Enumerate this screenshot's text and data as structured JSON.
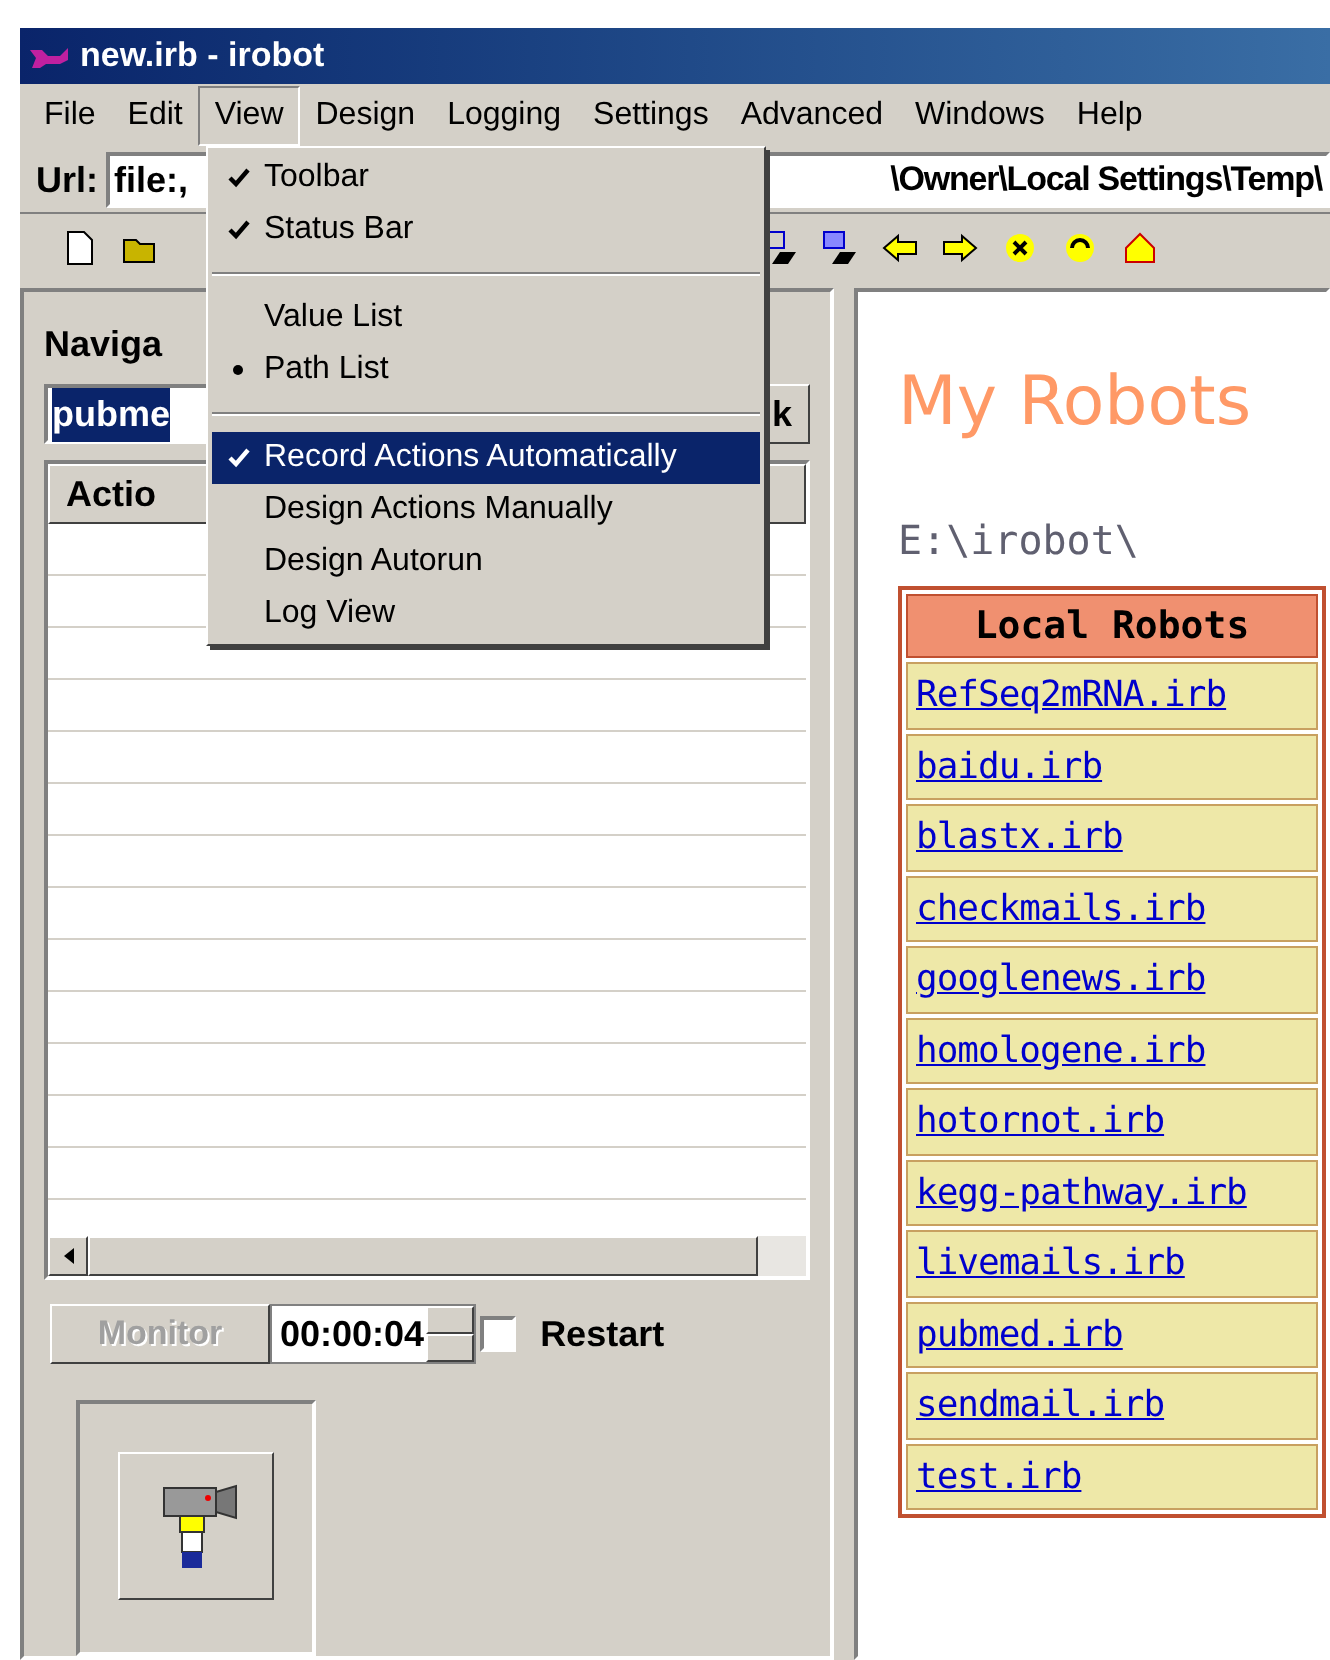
{
  "window": {
    "title": "new.irb - irobot"
  },
  "menu_bar": [
    {
      "label": "File",
      "selected": false
    },
    {
      "label": "Edit",
      "selected": false
    },
    {
      "label": "View",
      "selected": true
    },
    {
      "label": "Design",
      "selected": false
    },
    {
      "label": "Logging",
      "selected": false
    },
    {
      "label": "Settings",
      "selected": false
    },
    {
      "label": "Advanced",
      "selected": false
    },
    {
      "label": "Windows",
      "selected": false
    },
    {
      "label": "Help",
      "selected": false
    }
  ],
  "url": {
    "label": "Url:",
    "value_start": "file:,",
    "value_end": "\\Owner\\Local Settings\\Temp\\"
  },
  "view_menu": [
    {
      "kind": "check",
      "label": "Toolbar",
      "checked": true,
      "selected": false
    },
    {
      "kind": "check",
      "label": "Status Bar",
      "checked": true,
      "selected": false
    },
    {
      "kind": "separator"
    },
    {
      "kind": "plain",
      "label": "Value List",
      "selected": false
    },
    {
      "kind": "radio",
      "label": "Path List",
      "checked": true,
      "selected": false
    },
    {
      "kind": "separator"
    },
    {
      "kind": "check",
      "label": "Record Actions Automatically",
      "checked": true,
      "selected": true
    },
    {
      "kind": "plain",
      "label": "Design Actions Manually",
      "selected": false
    },
    {
      "kind": "plain",
      "label": "Design Autorun",
      "selected": false
    },
    {
      "kind": "plain",
      "label": "Log View",
      "selected": false
    }
  ],
  "left_panel": {
    "title": "Naviga",
    "field_value": "pubme",
    "button_label": "k",
    "list_header": "Actio",
    "monitor_button": {
      "label": "Monitor",
      "disabled": true
    },
    "timer": "00:00:04",
    "restart": {
      "label": "Restart",
      "checked": false
    }
  },
  "browser": {
    "heading": "My Robots",
    "path": "E:\\irobot\\",
    "table_header": "Local Robots",
    "robots": [
      "RefSeq2mRNA.irb",
      "baidu.irb",
      "blastx.irb",
      "checkmails.irb",
      "googlenews.irb",
      "homologene.irb",
      "hotornot.irb",
      "kegg-pathway.irb",
      "livemails.irb",
      "pubmed.irb",
      "sendmail.irb",
      "test.irb"
    ]
  }
}
